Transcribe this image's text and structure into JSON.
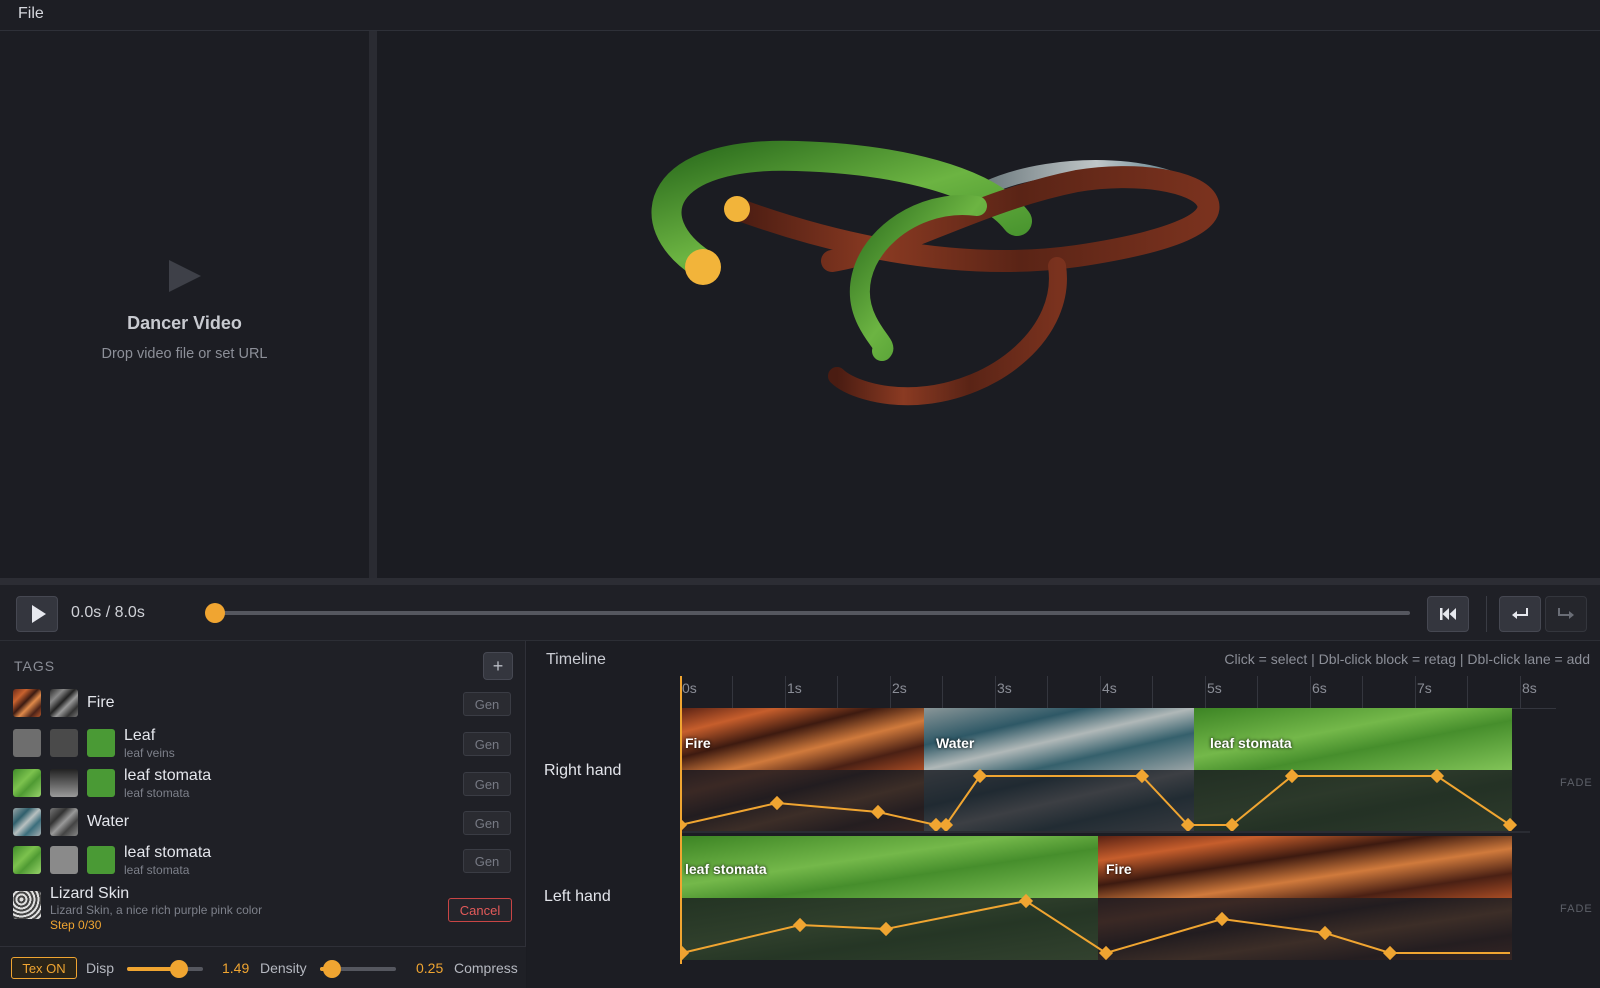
{
  "menu": {
    "file_label": "File"
  },
  "video_pane": {
    "title": "Dancer Video",
    "hint": "Drop video file or set URL"
  },
  "transport": {
    "time_readout": "0.0s / 8.0s",
    "progress": 0.0
  },
  "tags_panel": {
    "title": "TAGS",
    "add_label": "+",
    "gen_label": "Gen",
    "tags": [
      {
        "name": "Fire",
        "subtitle": ""
      },
      {
        "name": "Leaf",
        "subtitle": "leaf veins"
      },
      {
        "name": "leaf stomata",
        "subtitle": "leaf stomata"
      },
      {
        "name": "Water",
        "subtitle": ""
      },
      {
        "name": "leaf stomata",
        "subtitle": "leaf stomata"
      },
      {
        "name": "Lizard Skin",
        "subtitle": "Lizard Skin, a nice rich purple pink color",
        "status": "Step 0/30",
        "action": "Cancel"
      }
    ]
  },
  "controls": {
    "tex_toggle": "Tex ON",
    "disp_label": "Disp",
    "disp_value": "1.49",
    "density_label": "Density",
    "density_value": "0.25",
    "compress_label": "Compress"
  },
  "timeline": {
    "title": "Timeline",
    "hint": "Click = select | Dbl-click block = retag | Dbl-click lane = add",
    "ticks": [
      "0s",
      "1s",
      "2s",
      "3s",
      "4s",
      "5s",
      "6s",
      "7s",
      "8s"
    ],
    "fade_label": "FADE",
    "lanes": [
      {
        "name": "Right hand",
        "blocks": [
          {
            "tag": "Fire",
            "start": 0.0,
            "end": 2.3
          },
          {
            "tag": "Water",
            "start": 2.3,
            "end": 5.0
          },
          {
            "tag": "leaf stomata",
            "start": 5.0,
            "end": 8.0
          }
        ]
      },
      {
        "name": "Left hand",
        "blocks": [
          {
            "tag": "leaf stomata",
            "start": 0.0,
            "end": 4.0
          },
          {
            "tag": "Fire",
            "start": 4.0,
            "end": 8.0
          }
        ]
      }
    ]
  },
  "colors": {
    "accent": "#f0a531",
    "danger": "#e35a5a",
    "background": "#1b1c22"
  }
}
